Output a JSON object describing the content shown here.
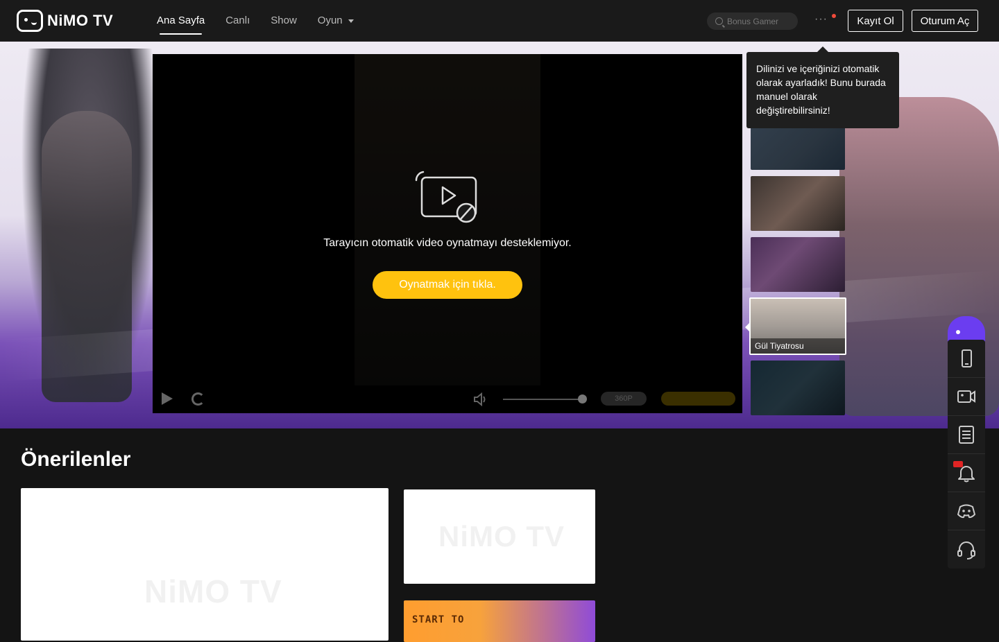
{
  "brand": {
    "name": "NiMO TV"
  },
  "nav": {
    "items": [
      {
        "label": "Ana Sayfa",
        "active": true
      },
      {
        "label": "Canlı",
        "active": false
      },
      {
        "label": "Show",
        "active": false
      },
      {
        "label": "Oyun",
        "active": false,
        "dropdown": true
      }
    ]
  },
  "search": {
    "placeholder": "Bonus Gamer",
    "value": ""
  },
  "header": {
    "more": "···",
    "signup": "Kayıt Ol",
    "login": "Oturum Aç"
  },
  "tooltip": {
    "text": "Dilinizi ve içeriğinizi otomatik olarak ayarladık! Bunu burada manuel olarak değiştirebilirsiniz!"
  },
  "player": {
    "message": "Tarayıcın otomatik video oynatmayı desteklemiyor.",
    "play_button": "Oynatmak için tıkla.",
    "quality": "360P",
    "volume_level": 0.95
  },
  "thumbnails": {
    "active_label": "Gül Tiyatrosu"
  },
  "recommended": {
    "title": "Önerilenler",
    "watermark": "NiMO TV",
    "banner_text": "START TO"
  },
  "colors": {
    "accent": "#ffc20e",
    "topbar": "#1a1a1a",
    "background": "#141414",
    "notification_dot": "#f04a3a"
  }
}
